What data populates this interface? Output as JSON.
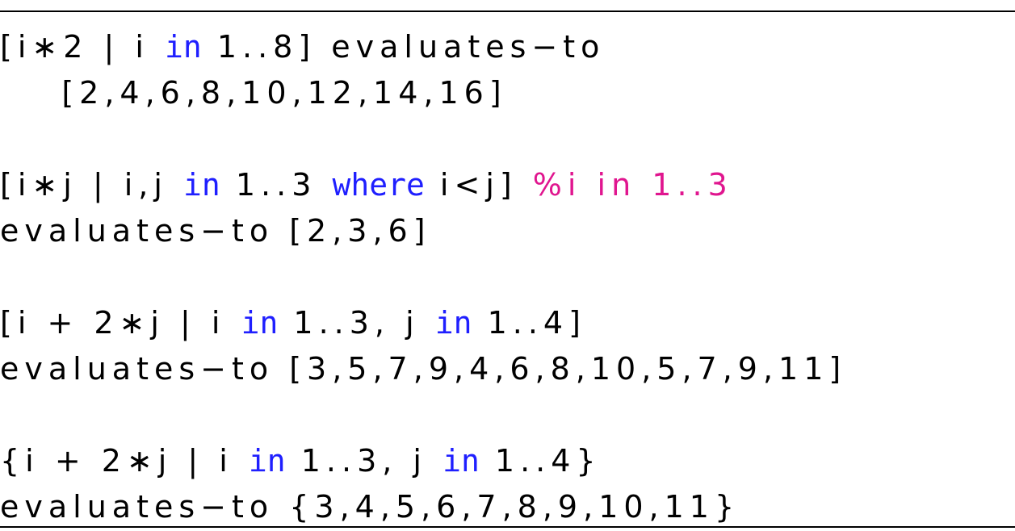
{
  "colors": {
    "text": "#000000",
    "keyword": "#1f1fff",
    "comment": "#e0168f",
    "rule": "#000000"
  },
  "lines": [
    {
      "tokens": [
        {
          "t": "[i∗2 | i ",
          "c": "text"
        },
        {
          "t": "in",
          "c": "keyword"
        },
        {
          "t": " 1..8] evaluates−to",
          "c": "text"
        }
      ]
    },
    {
      "tokens": [
        {
          "t": "    [2,4,6,8,10,12,14,16]",
          "c": "text"
        }
      ]
    },
    {
      "tokens": [
        {
          "t": "[i∗j | i,j ",
          "c": "text"
        },
        {
          "t": "in",
          "c": "keyword"
        },
        {
          "t": " 1..3 ",
          "c": "text"
        },
        {
          "t": "where",
          "c": "keyword"
        },
        {
          "t": " i<j] ",
          "c": "text"
        },
        {
          "t": "%i in 1..3",
          "c": "comment"
        }
      ]
    },
    {
      "tokens": [
        {
          "t": "evaluates−to [2,3,6]",
          "c": "text"
        }
      ]
    },
    {
      "tokens": [
        {
          "t": "[i + 2∗j | i ",
          "c": "text"
        },
        {
          "t": "in",
          "c": "keyword"
        },
        {
          "t": " 1..3, j ",
          "c": "text"
        },
        {
          "t": "in",
          "c": "keyword"
        },
        {
          "t": " 1..4]",
          "c": "text"
        }
      ]
    },
    {
      "tokens": [
        {
          "t": "evaluates−to [3,5,7,9,4,6,8,10,5,7,9,11]",
          "c": "text"
        }
      ]
    },
    {
      "tokens": [
        {
          "t": "{i + 2∗j | i ",
          "c": "text"
        },
        {
          "t": "in",
          "c": "keyword"
        },
        {
          "t": " 1..3, j ",
          "c": "text"
        },
        {
          "t": "in",
          "c": "keyword"
        },
        {
          "t": " 1..4}",
          "c": "text"
        }
      ]
    },
    {
      "tokens": [
        {
          "t": "evaluates−to {3,4,5,6,7,8,9,10,11}",
          "c": "text"
        }
      ]
    }
  ]
}
